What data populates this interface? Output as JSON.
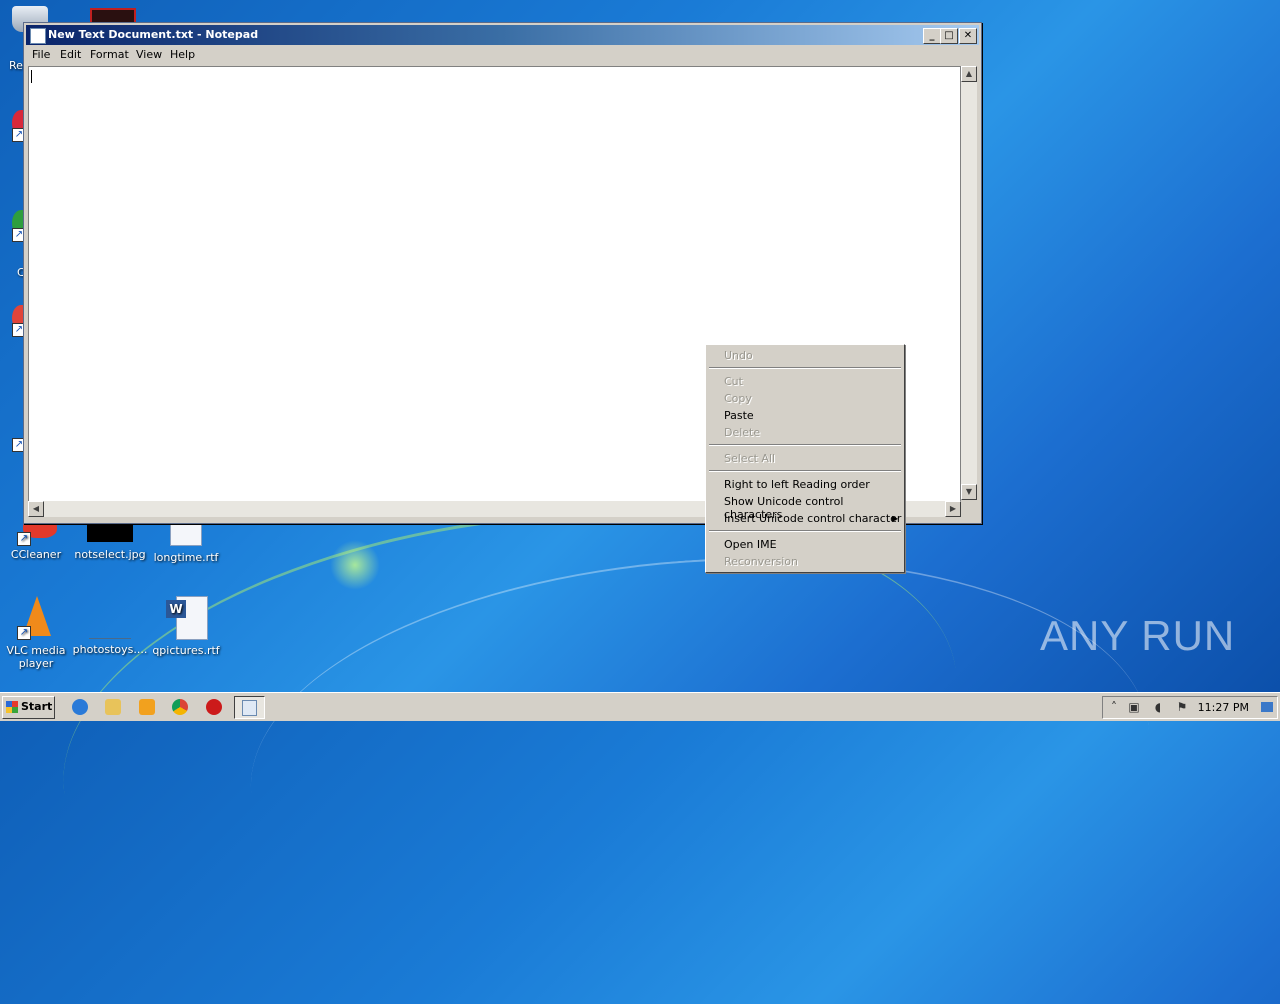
{
  "window": {
    "title": "New Text Document.txt - Notepad",
    "controls": {
      "minimize": "_",
      "maximize": "□",
      "close": "✕"
    }
  },
  "menubar": [
    "File",
    "Edit",
    "Format",
    "View",
    "Help"
  ],
  "editor": {
    "content": ""
  },
  "context_menu": {
    "undo": "Undo",
    "cut": "Cut",
    "copy": "Copy",
    "paste": "Paste",
    "delete": "Delete",
    "select_all": "Select All",
    "rtl": "Right to left Reading order",
    "show_unicode": "Show Unicode control characters",
    "insert_unicode": "Insert Unicode control character",
    "open_ime": "Open IME",
    "reconversion": "Reconversion"
  },
  "desktop_icons": {
    "ccleaner": "CCleaner",
    "notselect": "notselect.jpg",
    "longtime": "longtime.rtf",
    "vlc": "VLC media player",
    "photostoys": "photostoys....",
    "qpictures": "qpictures.rtf",
    "re_fragment": "Re",
    "c_fragment": "C"
  },
  "watermark": "ANY RUN",
  "taskbar": {
    "start_label": "Start",
    "clock": "11:27 PM"
  },
  "colors": {
    "desktop_blue": "#1a7bd6",
    "title_active": "#0a246a"
  }
}
